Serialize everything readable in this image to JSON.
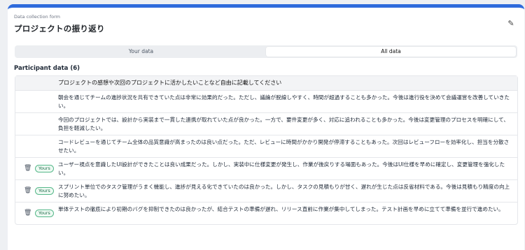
{
  "form": {
    "type_label": "Data collection form",
    "title": "プロジェクトの振り返り"
  },
  "tabs": [
    {
      "label": "Your data",
      "active": false
    },
    {
      "label": "All data",
      "active": true
    }
  ],
  "participants": {
    "heading": "Participant data (6)",
    "column_header": "プロジェクトの感想や次回のプロジェクトに活かしたいことなど自由に記載してください",
    "yours_label": "Yours",
    "rows": [
      {
        "text": "朝会を通じてチームの進捗状況を共有できていた点は非常に効果的だった。ただし、議論が脱線しやすく、時間が超過することも多かった。今後は進行役を決めて会議運営を改善していきたい。",
        "yours": false
      },
      {
        "text": "今回のプロジェクトでは、設計から実装まで一貫した連携が取れていた点が良かった。一方で、要件変更が多く、対応に追われることも多かった。今後は変更管理のプロセスを明確にして、負担を軽減したい。",
        "yours": false
      },
      {
        "text": "コードレビューを通じてチーム全体の品質意識が高まったのは良い点だった。ただ、レビューに時間がかかり開発が停滞することもあった。次回はレビューフローを効率化し、担当を分散させたい。",
        "yours": false
      },
      {
        "text": "ユーザー視点を意識したUI設計ができたことは良い成果だった。しかし、実装中に仕様変更が発生し、作業が後戻りする場面もあった。今後はUI仕様を早めに確定し、変更管理を強化したい。",
        "yours": true
      },
      {
        "text": "スプリント単位でのタスク管理がうまく機能し、進捗が見える化できていたのは良かった。しかし、タスクの見積もりが甘く、遅れが生じた点は反省材料である。今後は見積もり精度の向上に努めたい。",
        "yours": true
      },
      {
        "text": "単体テストの徹底により初期のバグを抑制できたのは良かったが、結合テストの準備が遅れ、リリース直前に作業が集中してしまった。テスト計画を早めに立てて準備を並行で進めたい。",
        "yours": true
      }
    ]
  },
  "colors": {
    "accent": "#2f6bdc",
    "badge_border": "#56b88a",
    "badge_text": "#1f6b4a"
  },
  "icons": {
    "edit": "pencil-icon",
    "delete": "trash-icon"
  }
}
